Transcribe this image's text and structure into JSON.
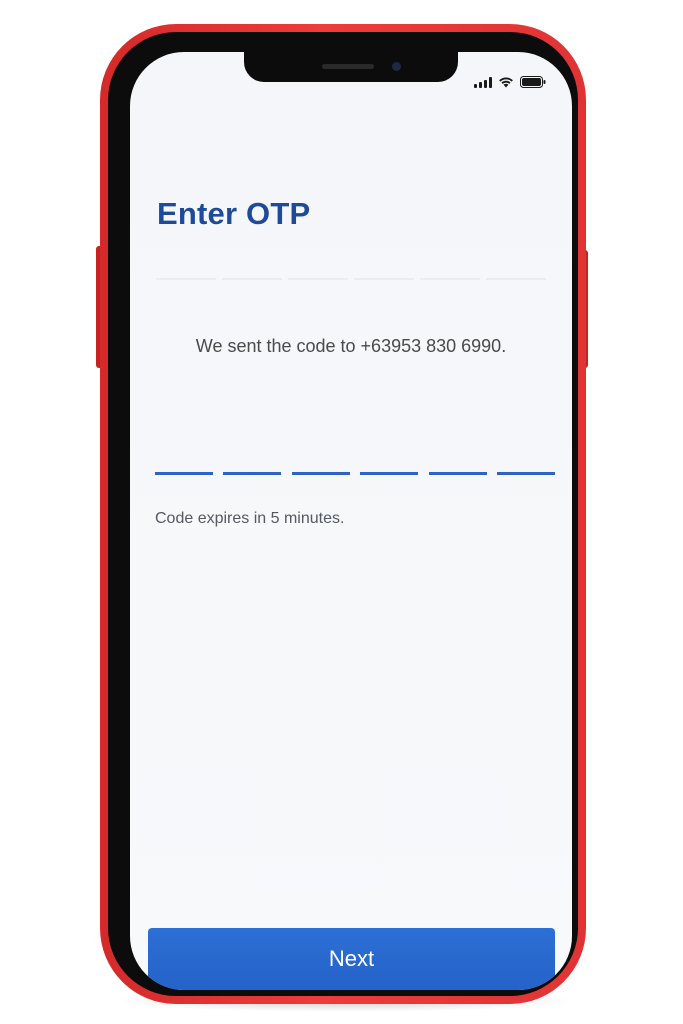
{
  "otp_screen": {
    "title": "Enter OTP",
    "sent_message": "We sent the code to +63953 830 6990.",
    "otp_digits": [
      "",
      "",
      "",
      "",
      "",
      ""
    ],
    "expiry_note": "Code expires in 5 minutes.",
    "next_label": "Next"
  },
  "status_bar": {
    "icons": [
      "cellular-signal-icon",
      "wifi-icon",
      "battery-icon"
    ]
  },
  "colors": {
    "phone_frame": "#e53535",
    "title": "#1d4b9a",
    "otp_underline": "#2e63c4",
    "button": "#2a69cf"
  }
}
